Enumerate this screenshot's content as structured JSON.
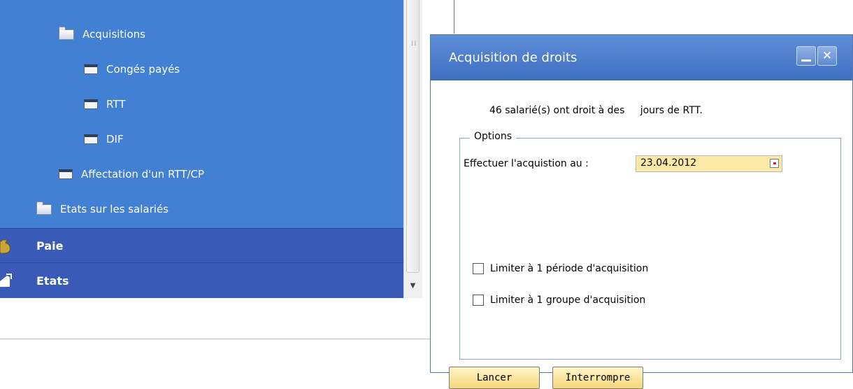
{
  "nav": {
    "tree": [
      {
        "label": "Acquisitions",
        "icon": "open-folder-icon"
      },
      {
        "label": "Congés payés",
        "icon": "form-icon"
      },
      {
        "label": "RTT",
        "icon": "form-icon"
      },
      {
        "label": "DIF",
        "icon": "form-icon"
      },
      {
        "label": "Affectation d'un RTT/CP",
        "icon": "form-icon"
      },
      {
        "label": "Etats sur les salariés",
        "icon": "folder-icon"
      }
    ],
    "sections": [
      {
        "label": "Paie",
        "icon": "money-bag-icon"
      },
      {
        "label": "Etats",
        "icon": "chart-icon"
      }
    ]
  },
  "dialog": {
    "title": "Acquisition de droits",
    "info": "46 salarié(s) ont droit à des     jours de RTT.",
    "options_title": "Options",
    "acq_label": "Effectuer l'acquistion au :",
    "acq_date": "23.04.2012",
    "checkboxes": [
      {
        "label": "Limiter à 1 période d'acquisition",
        "checked": false
      },
      {
        "label": "Limiter à 1 groupe d'acquisition",
        "checked": false
      }
    ],
    "buttons": {
      "launch": "Lancer",
      "interrupt": "Interrompre"
    }
  },
  "colors": {
    "nav_background": "#4280d3",
    "section_bar": "#3a5ab8",
    "dialog_titlebar": "#4a7ccc",
    "input_background": "#fde9a6",
    "button_background": "#f5d77a"
  }
}
